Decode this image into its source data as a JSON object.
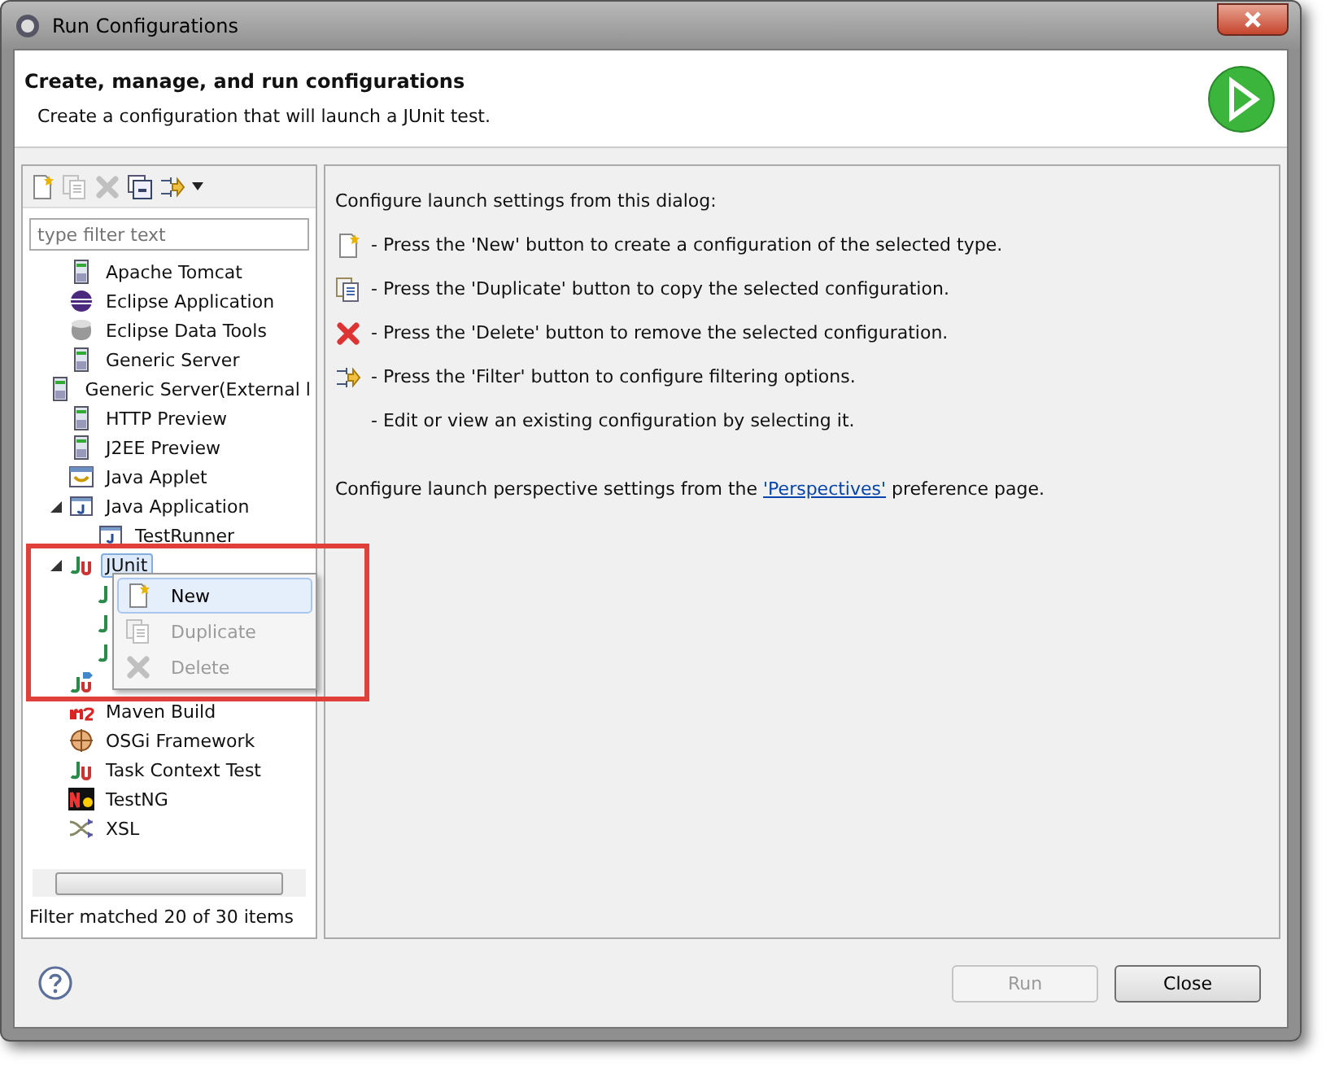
{
  "window": {
    "title": "Run Configurations"
  },
  "header": {
    "title": "Create, manage, and run configurations",
    "subtitle": "Create a configuration that will launch a JUnit test."
  },
  "toolbar": [
    {
      "kind": "new",
      "disabled": false
    },
    {
      "kind": "duplicate",
      "disabled": true
    },
    {
      "kind": "delete",
      "disabled": true
    },
    {
      "kind": "collapse",
      "disabled": false
    },
    {
      "kind": "filter",
      "disabled": false
    }
  ],
  "filter": {
    "placeholder": "type filter text"
  },
  "tree": [
    {
      "label": "Apache Tomcat",
      "kind": "server"
    },
    {
      "label": "Eclipse Application",
      "kind": "eclipse"
    },
    {
      "label": "Eclipse Data Tools",
      "kind": "database"
    },
    {
      "label": "Generic Server",
      "kind": "server"
    },
    {
      "label": "Generic Server(External l",
      "kind": "server"
    },
    {
      "label": "HTTP Preview",
      "kind": "server"
    },
    {
      "label": "J2EE Preview",
      "kind": "server"
    },
    {
      "label": "Java Applet",
      "kind": "applet"
    },
    {
      "label": "Java Application",
      "kind": "java",
      "expanded": true,
      "children": [
        {
          "label": "TestRunner",
          "kind": "javafile"
        }
      ]
    },
    {
      "label": "JUnit",
      "kind": "junit",
      "expanded": true,
      "selected": true,
      "children": [
        {
          "kind": "junitfile"
        },
        {
          "kind": "junitfile"
        },
        {
          "kind": "junitfile"
        }
      ]
    },
    {
      "kind": "junitplugin"
    },
    {
      "label": "Maven Build",
      "kind": "maven"
    },
    {
      "label": "OSGi Framework",
      "kind": "osgi"
    },
    {
      "label": "Task Context Test",
      "kind": "junit"
    },
    {
      "label": "TestNG",
      "kind": "testng"
    },
    {
      "label": "XSL",
      "kind": "xsl"
    }
  ],
  "status": "Filter matched 20 of 30 items",
  "context_menu": [
    {
      "label": "New",
      "kind": "new",
      "disabled": false,
      "selected": true
    },
    {
      "label": "Duplicate",
      "kind": "duplicate",
      "disabled": true,
      "selected": false
    },
    {
      "label": "Delete",
      "kind": "delete",
      "disabled": true,
      "selected": false
    }
  ],
  "help": {
    "intro": "Configure launch settings from this dialog:",
    "lines": [
      {
        "kind": "new",
        "text": "- Press the 'New' button to create a configuration of the selected type."
      },
      {
        "kind": "duplicate",
        "text": "- Press the 'Duplicate' button to copy the selected configuration."
      },
      {
        "kind": "delete",
        "text": "- Press the 'Delete' button to remove the selected configuration."
      },
      {
        "kind": "filter",
        "text": "- Press the 'Filter' button to configure filtering options."
      },
      {
        "kind": "none",
        "text": "- Edit or view an existing configuration by selecting it."
      }
    ],
    "perspective_before": "Configure launch perspective settings from the",
    "perspective_link": "'Perspectives'",
    "perspective_after": "preference page."
  },
  "buttons": [
    {
      "label": "Run",
      "disabled": true
    },
    {
      "label": "Close",
      "disabled": false
    }
  ]
}
